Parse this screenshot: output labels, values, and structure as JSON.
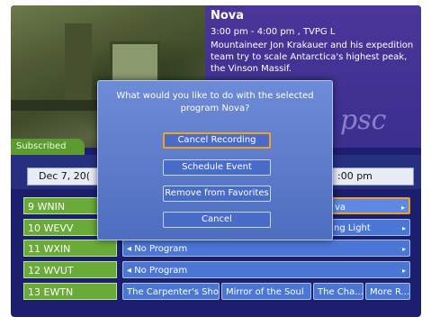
{
  "program": {
    "title": "Nova",
    "time": "3:00 pm - 4:00 pm , TVPG L",
    "description": "Mountaineer Jon Krakauer and his expedition team try to scale Antarctica's highest peak, the Vinson Massif."
  },
  "logo": "psc",
  "tab": "Subscribed",
  "date": "Dec 7, 20(",
  "time": ":00 pm",
  "dialog": {
    "message_line1": "What would you like to do with the selected",
    "message_line2": "program Nova?",
    "buttons": [
      "Cancel Recording",
      "Schedule Event",
      "Remove from Favorites",
      "Cancel"
    ],
    "focused": "Cancel Recording"
  },
  "channels": [
    {
      "name": "9 WNIN",
      "programs": [
        {
          "label": "va",
          "arrow": "▸",
          "selected": true
        }
      ]
    },
    {
      "name": "10 WEVV",
      "programs": [
        {
          "label": "ng Light",
          "arrow": "▸"
        }
      ]
    },
    {
      "name": "11 WXIN",
      "programs": [
        {
          "label": "◂ No Program",
          "arrow": "▸"
        }
      ]
    },
    {
      "name": "12 WVUT",
      "programs": [
        {
          "label": "◂ No Program",
          "arrow": "▸"
        }
      ]
    },
    {
      "name": "13 EWTN",
      "programs": [
        {
          "label": "The Carpenter's Shop"
        },
        {
          "label": "Mirror of the Soul"
        },
        {
          "label": "The Cha..."
        },
        {
          "label": "More R..."
        }
      ]
    }
  ],
  "colors": {
    "accent": "#f3a21f",
    "channel": "#6aaa38",
    "program": "#4b76d6"
  }
}
